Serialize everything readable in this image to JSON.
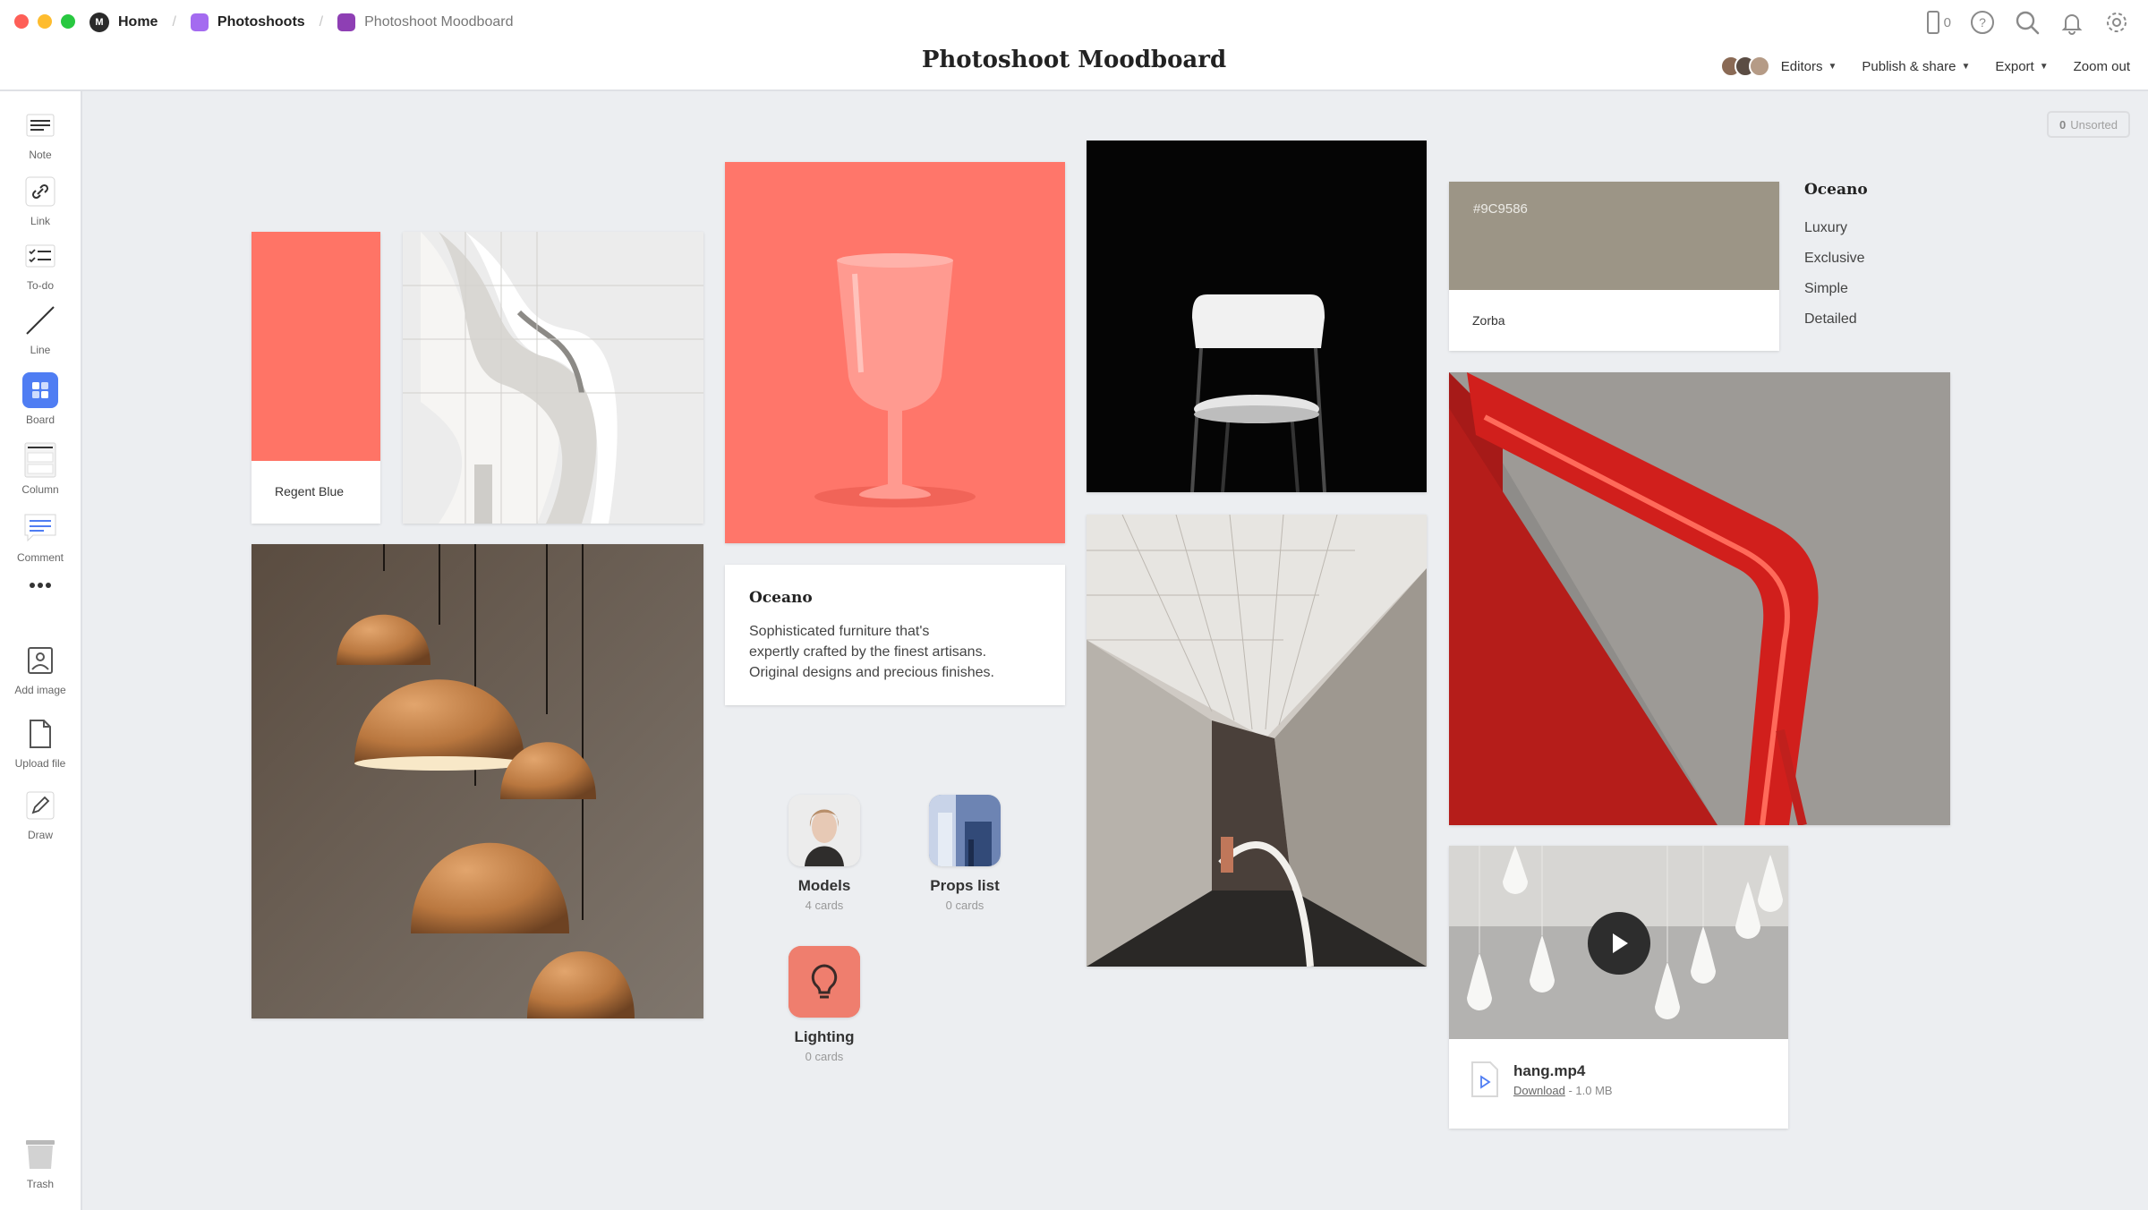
{
  "breadcrumb": {
    "home": "Home",
    "photoshoots": "Photoshoots",
    "moodboard": "Photoshoot Moodboard",
    "colors": {
      "photoshoots": "#a46bf0",
      "moodboard": "#8e3fb4"
    }
  },
  "header": {
    "title": "Photoshoot Moodboard",
    "device_count": "0",
    "editors_label": "Editors",
    "publish_label": "Publish & share",
    "export_label": "Export",
    "zoom_label": "Zoom out"
  },
  "toolbar": {
    "note": "Note",
    "link": "Link",
    "todo": "To-do",
    "line": "Line",
    "board": "Board",
    "column": "Column",
    "comment": "Comment",
    "add_image": "Add image",
    "upload_file": "Upload file",
    "draw": "Draw",
    "trash": "Trash",
    "accent": "#4f7df3"
  },
  "canvas": {
    "unsorted_count": "0",
    "unsorted_label": "Unsorted",
    "swatch_coral": {
      "label": "Regent Blue",
      "color": "#ff7466"
    },
    "swatch_taupe": {
      "hex": "#9C9586",
      "label": "Zorba",
      "color": "#9c9586"
    },
    "text_card": {
      "title": "Oceano",
      "lines": [
        "Sophisticated furniture that's",
        "expertly crafted by the finest artisans.",
        "Original designs and precious finishes."
      ]
    },
    "tag_list": {
      "title": "Oceano",
      "items": [
        "Luxury",
        "Exclusive",
        "Simple",
        "Detailed"
      ]
    },
    "boards": [
      {
        "name": "Models",
        "count": "4 cards"
      },
      {
        "name": "Props list",
        "count": "0 cards"
      },
      {
        "name": "Lighting",
        "count": "0 cards"
      }
    ],
    "video": {
      "filename": "hang.mp4",
      "download_label": "Download",
      "size": "- 1.0 MB"
    }
  }
}
